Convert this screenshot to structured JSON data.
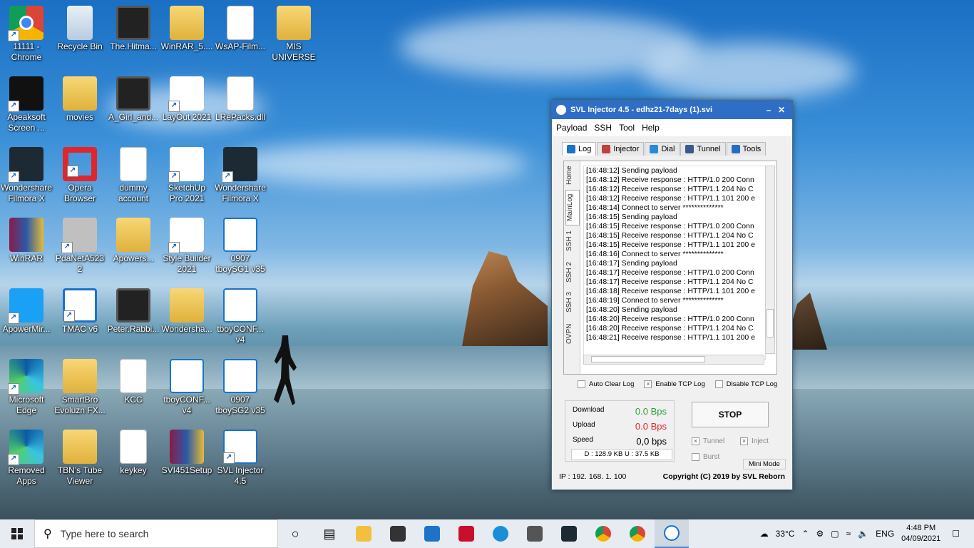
{
  "desktop": {
    "icons": [
      {
        "label": "11111 - Chrome"
      },
      {
        "label": "Recycle Bin"
      },
      {
        "label": "The.Hitma..."
      },
      {
        "label": "WinRAR_5...."
      },
      {
        "label": "WsAP-Film..."
      },
      {
        "label": "MIS UNIVERSE"
      },
      {
        "label": "Apeaksoft Screen ..."
      },
      {
        "label": "movies"
      },
      {
        "label": "A_Girl_and..."
      },
      {
        "label": "LayOut 2021"
      },
      {
        "label": "LRePacks.dll"
      },
      {
        "label": "Wondershare Filmora X"
      },
      {
        "label": "Opera Browser"
      },
      {
        "label": "dummy account"
      },
      {
        "label": "SketchUp Pro 2021"
      },
      {
        "label": "Wondershare Filmora X"
      },
      {
        "label": "WinRAR"
      },
      {
        "label": "PdaNetA5232"
      },
      {
        "label": "Apowers..."
      },
      {
        "label": "Style Builder 2021"
      },
      {
        "label": "0907 tboySG1 v35"
      },
      {
        "label": "ApowerMir..."
      },
      {
        "label": "TMAC v6"
      },
      {
        "label": "Peter.Rabbi..."
      },
      {
        "label": "Wondersha..."
      },
      {
        "label": "tboyCONF... v4"
      },
      {
        "label": "Microsoft Edge"
      },
      {
        "label": "SmartBro Evoluzn FX..."
      },
      {
        "label": "KCC"
      },
      {
        "label": "tboyCONF... v4"
      },
      {
        "label": "0907 tboySG2 v35"
      },
      {
        "label": "Removed Apps"
      },
      {
        "label": "TBN's Tube Viewer"
      },
      {
        "label": "keykey"
      },
      {
        "label": "SVI451Setup"
      },
      {
        "label": "SVL Injector 4.5"
      }
    ]
  },
  "window": {
    "title": "SVL Injector 4.5 - edhz21-7days (1).svi",
    "menu": [
      "Payload",
      "SSH",
      "Tool",
      "Help"
    ],
    "tabs": [
      "Log",
      "Injector",
      "Dial",
      "Tunnel",
      "Tools"
    ],
    "vtabs": [
      "Home",
      "MainLog",
      "SSH 1",
      "SSH 2",
      "SSH 3",
      "OVPN"
    ],
    "log": [
      "[16:48:12] Sending payload",
      "[16:48:12] Receive response : HTTP/1.0 200 Conn",
      "[16:48:12] Receive response : HTTP/1.1 204 No C",
      "[16:48:12] Receive response : HTTP/1.1 101 200 e",
      "[16:48:14] Connect to server **************",
      "[16:48:15] Sending payload",
      "[16:48:15] Receive response : HTTP/1.0 200 Conn",
      "[16:48:15] Receive response : HTTP/1.1 204 No C",
      "[16:48:15] Receive response : HTTP/1.1 101 200 e",
      "[16:48:16] Connect to server **************",
      "[16:48:17] Sending payload",
      "[16:48:17] Receive response : HTTP/1.0 200 Conn",
      "[16:48:17] Receive response : HTTP/1.1 204 No C",
      "[16:48:18] Receive response : HTTP/1.1 101 200 e",
      "[16:48:19] Connect to server **************",
      "[16:48:20] Sending payload",
      "[16:48:20] Receive response : HTTP/1.0 200 Conn",
      "[16:48:20] Receive response : HTTP/1.1 204 No C",
      "[16:48:21] Receive response : HTTP/1.1 101 200 e"
    ],
    "checks": {
      "auto_clear": "Auto Clear Log",
      "enable_tcp": "Enable TCP Log",
      "disable_tcp": "Disable TCP Log"
    },
    "stats": {
      "download_label": "Download",
      "download_value": "0.0 Bps",
      "upload_label": "Upload",
      "upload_value": "0.0 Bps",
      "speed_label": "Speed",
      "speed_value": "0,0 bps",
      "totals": "D :  128.9 KB     U :   37.5 KB"
    },
    "stop_label": "STOP",
    "options": {
      "tunnel": "Tunnel",
      "inject": "Inject",
      "burst": "Burst"
    },
    "mini_mode": "Mini Mode",
    "ip": "IP : 192. 168. 1. 100",
    "copyright": "Copyright (C) 2019 by SVL Reborn"
  },
  "taskbar": {
    "search_placeholder": "Type here to search",
    "temperature": "33°C",
    "language": "ENG",
    "time": "4:48 PM",
    "date": "04/09/2021"
  }
}
